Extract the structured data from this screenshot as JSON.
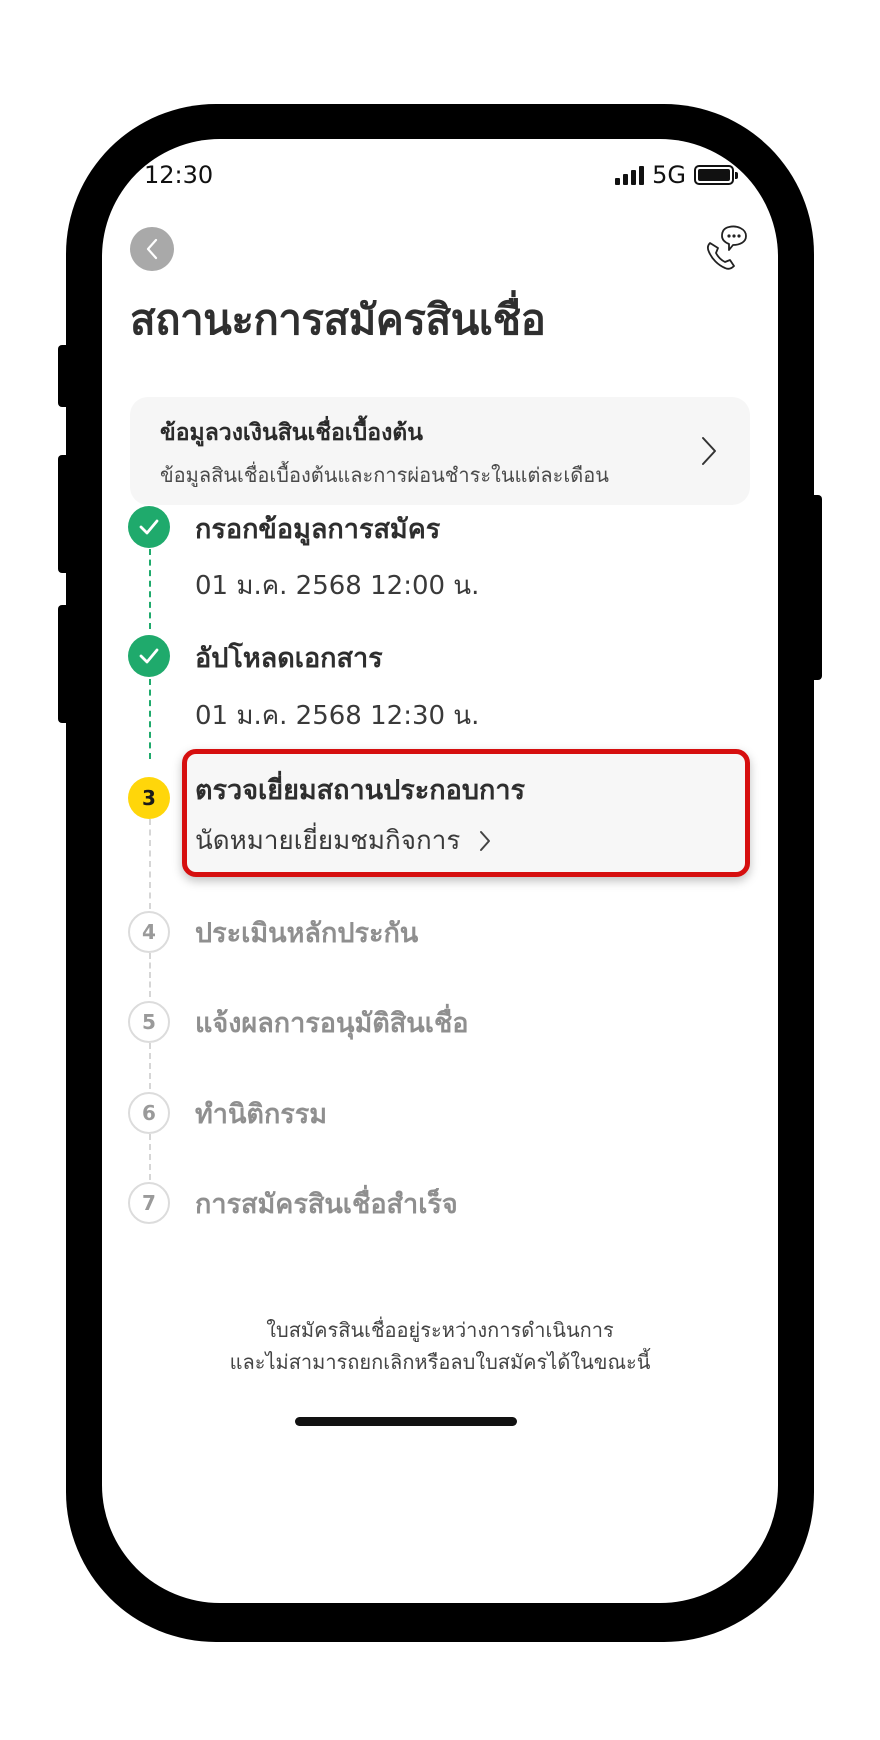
{
  "status_bar": {
    "time": "12:30",
    "network": "5G"
  },
  "header": {
    "title": "สถานะการสมัครสินเชื่อ"
  },
  "info_card": {
    "title": "ข้อมูลวงเงินสินเชื่อเบื้องต้น",
    "subtitle": "ข้อมูลสินเชื่อเบื้องต้นและการผ่อนชำระในแต่ละเดือน"
  },
  "steps": [
    {
      "number": "1",
      "title": "กรอกข้อมูลการสมัคร",
      "date": "01 ม.ค. 2568 12:00 น.",
      "state": "done"
    },
    {
      "number": "2",
      "title": "อัปโหลดเอกสาร",
      "date": "01 ม.ค. 2568 12:30 น.",
      "state": "done"
    },
    {
      "number": "3",
      "title": "ตรวจเยี่ยมสถานประกอบการ",
      "action": "นัดหมายเยี่ยมชมกิจการ",
      "state": "current"
    },
    {
      "number": "4",
      "title": "ประเมินหลักประกัน",
      "state": "pending"
    },
    {
      "number": "5",
      "title": "แจ้งผลการอนุมัติสินเชื่อ",
      "state": "pending"
    },
    {
      "number": "6",
      "title": "ทำนิติกรรม",
      "state": "pending"
    },
    {
      "number": "7",
      "title": "การสมัครสินเชื่อสำเร็จ",
      "state": "pending"
    }
  ],
  "footer": {
    "line1": "ใบสมัครสินเชื่ออยู่ระหว่างการดำเนินการ",
    "line2": "และไม่สามารถยกเลิกหรือลบใบสมัครได้ในขณะนี้"
  },
  "colors": {
    "done": "#1faa6c",
    "current": "#ffd60a",
    "highlight": "#d60f0f"
  },
  "icons": [
    "back-icon",
    "call-chat-icon",
    "check-icon",
    "chevron-right-icon",
    "signal-icon",
    "battery-icon"
  ]
}
